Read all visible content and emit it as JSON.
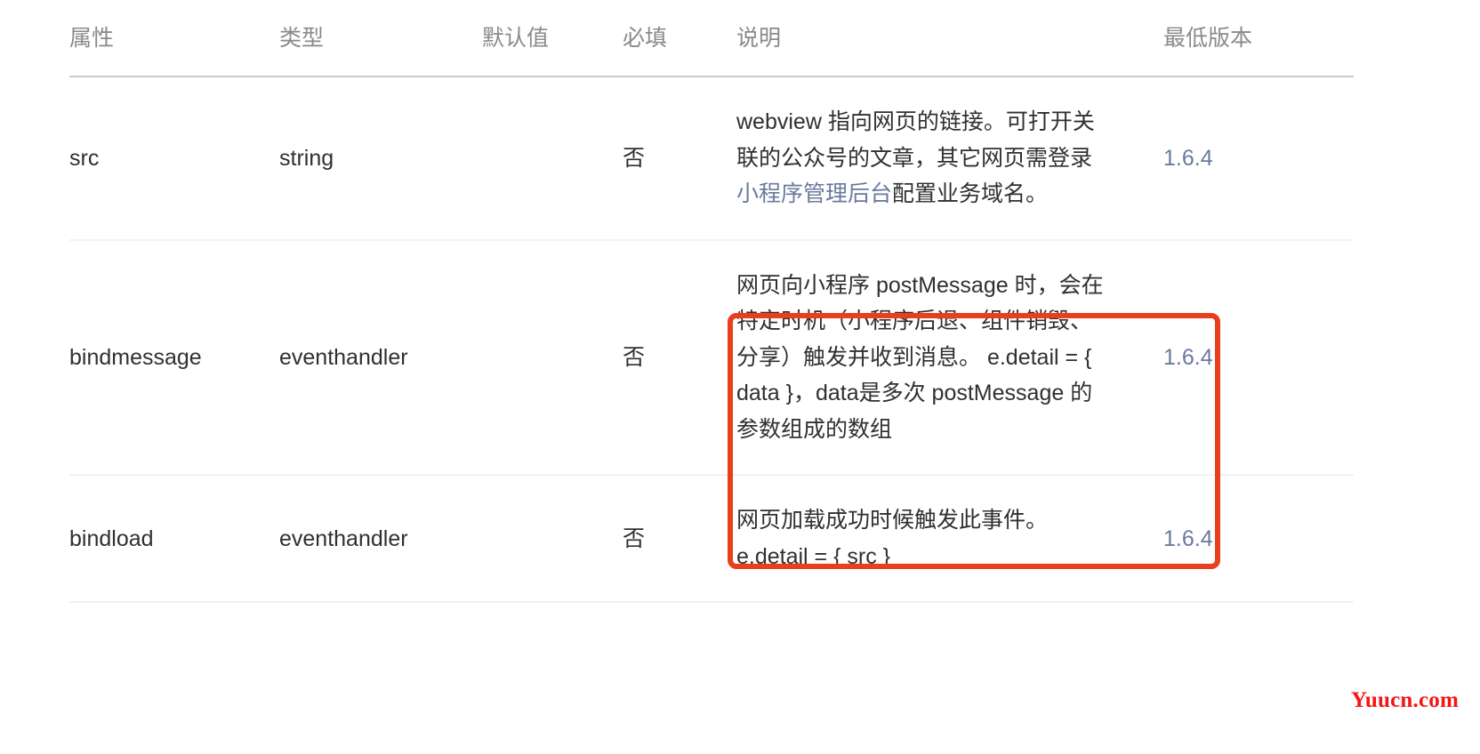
{
  "table": {
    "headers": [
      {
        "label": "属性"
      },
      {
        "label": "类型"
      },
      {
        "label": "默认值"
      },
      {
        "label": "必填"
      },
      {
        "label": "说明"
      },
      {
        "label": "最低版本"
      }
    ],
    "rows": [
      {
        "attribute": "src",
        "type": "string",
        "default": "",
        "required": "否",
        "desc_prefix": "webview 指向网页的链接。可打开关联的公众号的文章，其它网页需登录",
        "desc_link": "小程序管理后台",
        "desc_suffix": "配置业务域名。",
        "version": "1.6.4"
      },
      {
        "attribute": "bindmessage",
        "type": "eventhandler",
        "default": "",
        "required": "否",
        "desc_prefix": "网页向小程序 postMessage 时，会在特定时机（小程序后退、组件销毁、分享）触发并收到消息。 e.detail = { data }，data是多次 postMessage 的参数组成的数组",
        "desc_link": "",
        "desc_suffix": "",
        "version": "1.6.4"
      },
      {
        "attribute": "bindload",
        "type": "eventhandler",
        "default": "",
        "required": "否",
        "desc_prefix": "网页加载成功时候触发此事件。 e.detail = { src }",
        "desc_link": "",
        "desc_suffix": "",
        "version": "1.6.4"
      }
    ]
  },
  "annotation": {
    "highlight_color": "#e8401e",
    "highlight_target": "bindmessage-description"
  },
  "watermark": {
    "text": "Yuucn.com",
    "color": "#f41515"
  },
  "colors": {
    "header_text": "#8a8a8a",
    "body_text": "#2f3030",
    "link": "#6a7a9e",
    "row_divider": "#f2f2f2",
    "header_divider": "#c9c9c9"
  }
}
